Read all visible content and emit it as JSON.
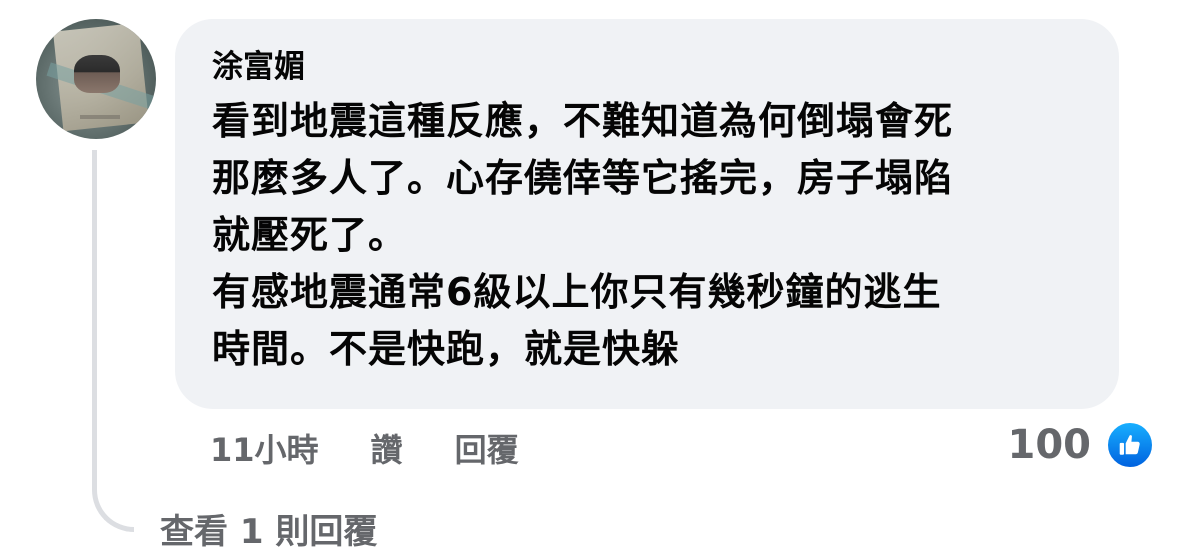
{
  "comment": {
    "author": "涂富媚",
    "lines": [
      "看到地震這種反應，不難知道為何倒塌會死",
      "那麼多人了。心存僥倖等它搖完，房子塌陷",
      "就壓死了。",
      "有感地震通常6級以上你只有幾秒鐘的逃生",
      "時間。不是快跑，就是快躲"
    ],
    "time": "11小時",
    "like_label": "讚",
    "reply_label": "回覆",
    "reaction_count": "100",
    "reaction_icon": "thumbs-up-icon",
    "view_replies": "查看 1 則回覆"
  },
  "colors": {
    "bubble_bg": "#f0f2f5",
    "secondary_text": "#65676b",
    "primary_text": "#050505",
    "like_blue": "#0866ff",
    "thread_line": "#dcdee2"
  }
}
